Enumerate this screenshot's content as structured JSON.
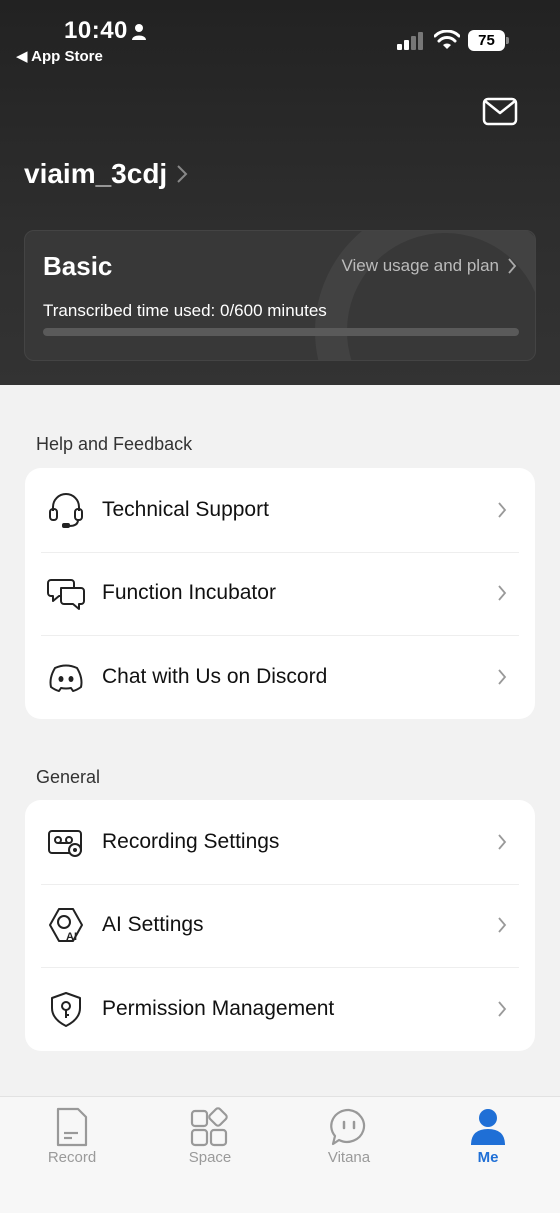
{
  "status_bar": {
    "time": "10:40",
    "back_label": "App Store",
    "battery": "75"
  },
  "profile": {
    "username": "viaim_3cdj"
  },
  "plan": {
    "name": "Basic",
    "link_label": "View usage and plan",
    "usage_text": "Transcribed time used: 0/600 minutes",
    "usage_used": 0,
    "usage_total": 600
  },
  "help": {
    "title": "Help and Feedback",
    "items": [
      {
        "label": "Technical Support",
        "icon": "headset-icon"
      },
      {
        "label": "Function Incubator",
        "icon": "chat-bubbles-icon"
      },
      {
        "label": "Chat with Us on Discord",
        "icon": "discord-icon"
      }
    ]
  },
  "general": {
    "title": "General",
    "items": [
      {
        "label": "Recording Settings",
        "icon": "recording-settings-icon"
      },
      {
        "label": "AI Settings",
        "icon": "ai-settings-icon"
      },
      {
        "label": "Permission Management",
        "icon": "shield-key-icon"
      }
    ]
  },
  "tabs": [
    {
      "label": "Record",
      "icon": "document-icon"
    },
    {
      "label": "Space",
      "icon": "apps-icon"
    },
    {
      "label": "Vitana",
      "icon": "chat-icon"
    },
    {
      "label": "Me",
      "icon": "person-icon",
      "active": true
    }
  ],
  "colors": {
    "accent": "#1f6fd6",
    "header_bg": "#2b2b2b",
    "page_bg": "#f2f2f2"
  }
}
